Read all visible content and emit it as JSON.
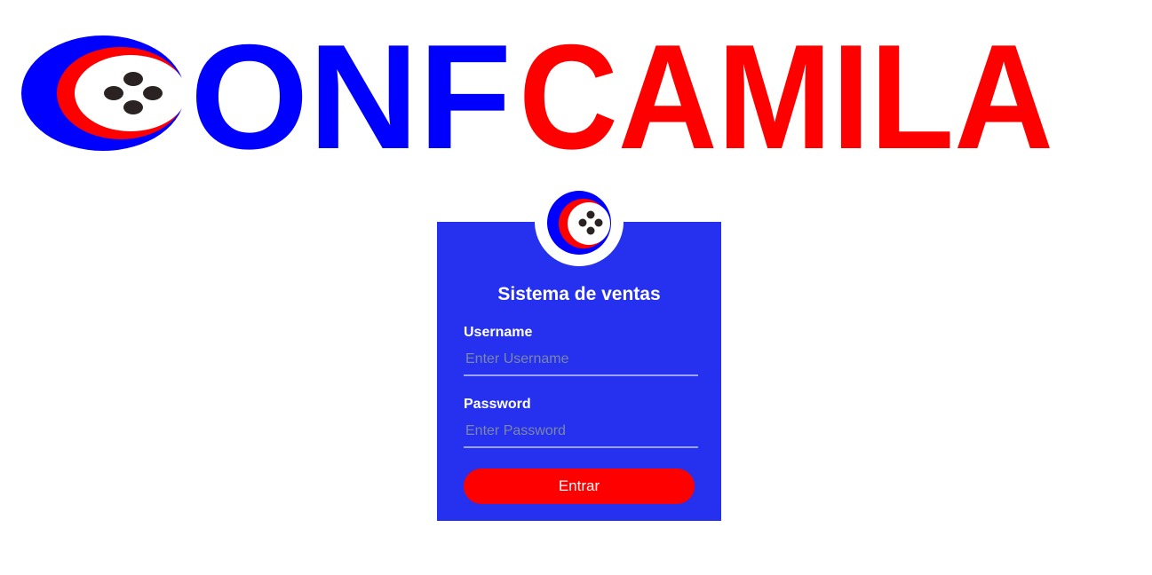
{
  "brand": {
    "logo_word_blue": "ONF",
    "logo_word_red": "CAMILA",
    "colors": {
      "blue": "#0000ff",
      "red": "#ff0000",
      "dark": "#2b2323"
    },
    "icon": "button-logo-icon"
  },
  "login": {
    "title": "Sistema de ventas",
    "username_label": "Username",
    "username_placeholder": "Enter Username",
    "username_value": "",
    "password_label": "Password",
    "password_placeholder": "Enter Password",
    "password_value": "",
    "submit_label": "Entrar",
    "avatar_icon": "button-logo-icon",
    "colors": {
      "card": "#2531ef",
      "button": "#ff0000",
      "text": "#ffffff"
    }
  }
}
